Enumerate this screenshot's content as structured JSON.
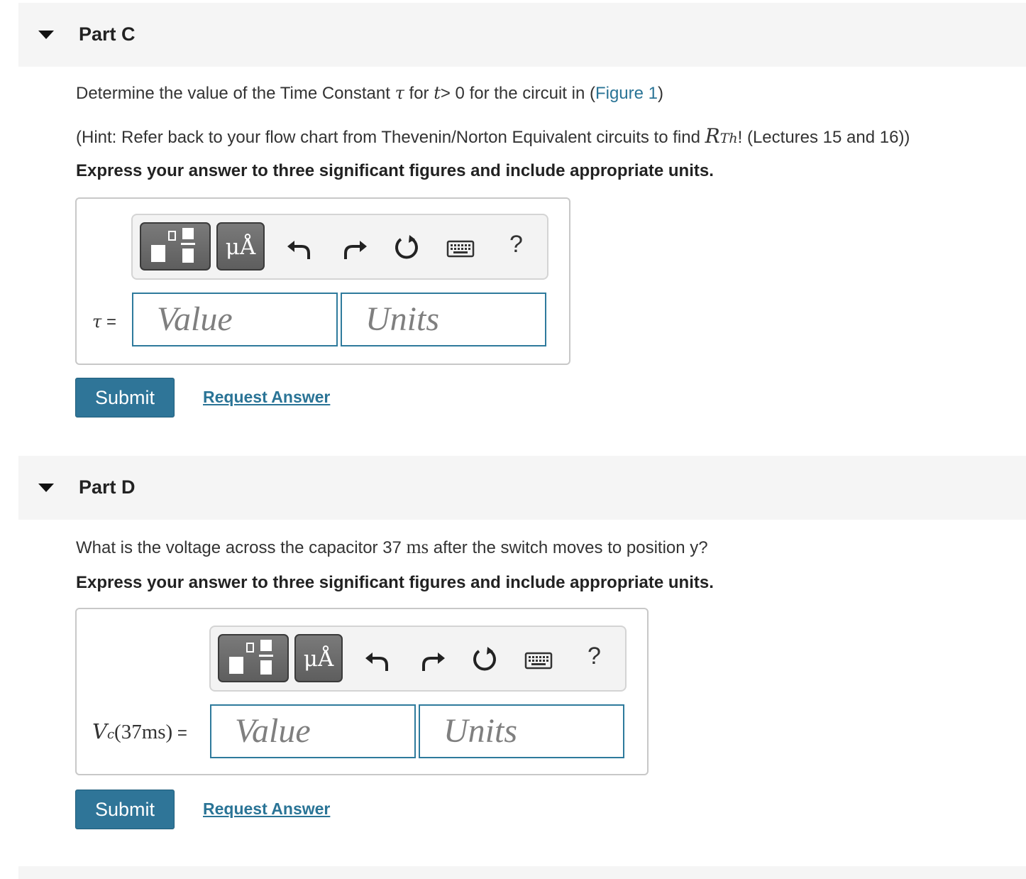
{
  "partC": {
    "title": "Part C",
    "q_prefix": "Determine the value of the Time Constant",
    "q_tau": "τ",
    "q_for": "for",
    "q_t": "t",
    "q_gt0": "> 0 for the circuit in (",
    "q_link": "Figure 1",
    "q_close": ")",
    "hint_prefix": "(Hint: Refer back to your flow chart from Thevenin/Norton Equivalent circuits to find",
    "hint_R": "R",
    "hint_sub": "Th",
    "hint_suffix": "! (Lectures 15 and 16))",
    "instruction": "Express your answer to three significant figures and include appropriate units.",
    "units_btn": "μÅ",
    "help": "?",
    "label_var": "τ",
    "label_eq": " =",
    "value_placeholder": "Value",
    "units_placeholder": "Units",
    "submit": "Submit",
    "request": "Request Answer"
  },
  "partD": {
    "title": "Part D",
    "q_prefix": "What is the voltage across the capacitor 37",
    "q_unit": "ms",
    "q_suffix": "after the switch moves to position y?",
    "instruction": "Express your answer to three significant figures and include appropriate units.",
    "units_btn": "μÅ",
    "help": "?",
    "label_V": "V",
    "label_sub": "c",
    "label_arg": "(37ms)",
    "label_eq": " =",
    "value_placeholder": "Value",
    "units_placeholder": "Units",
    "submit": "Submit",
    "request": "Request Answer"
  },
  "icons": [
    "caret-down-icon",
    "templates-icon",
    "undo-icon",
    "redo-icon",
    "reset-icon",
    "keyboard-icon",
    "help-icon"
  ],
  "colors": {
    "accent": "#2f7598",
    "link": "#2a7496",
    "field_border": "#2e7a9c"
  }
}
